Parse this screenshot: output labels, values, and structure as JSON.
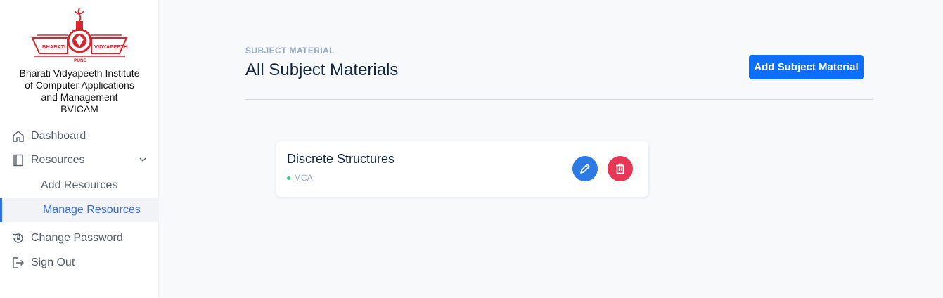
{
  "sidebar": {
    "logo": {
      "text_left": "BHARATI",
      "text_right": "VIDYAPEETH",
      "text_bottom": "PUNE",
      "text_arc": "BHARATI VIDYAPEETH PUNE"
    },
    "org_name_lines": [
      "Bharati Vidyapeeth Institute",
      "of Computer Applications",
      "and Management",
      "BVICAM"
    ],
    "nav": {
      "dashboard": {
        "label": "Dashboard",
        "icon": "home-icon"
      },
      "resources": {
        "label": "Resources",
        "icon": "book-icon",
        "expanded": true
      },
      "add_resources": {
        "label": "Add Resources"
      },
      "manage_resources": {
        "label": "Manage Resources",
        "active": true
      },
      "change_password": {
        "label": "Change Password",
        "icon": "lock-reset-icon"
      },
      "sign_out": {
        "label": "Sign Out",
        "icon": "sign-out-icon"
      }
    }
  },
  "main": {
    "pretitle": "SUBJECT MATERIAL",
    "title": "All Subject Materials",
    "add_button_label": "Add Subject Material",
    "items": [
      {
        "name": "Discrete Structures",
        "course": "MCA"
      }
    ]
  },
  "colors": {
    "accent": "#0d6efd",
    "edit": "#2c7be5",
    "delete": "#e63757",
    "active_nav": "#3a6fd8",
    "tag_dot": "#2bd27f",
    "logo_red": "#d7262e"
  }
}
